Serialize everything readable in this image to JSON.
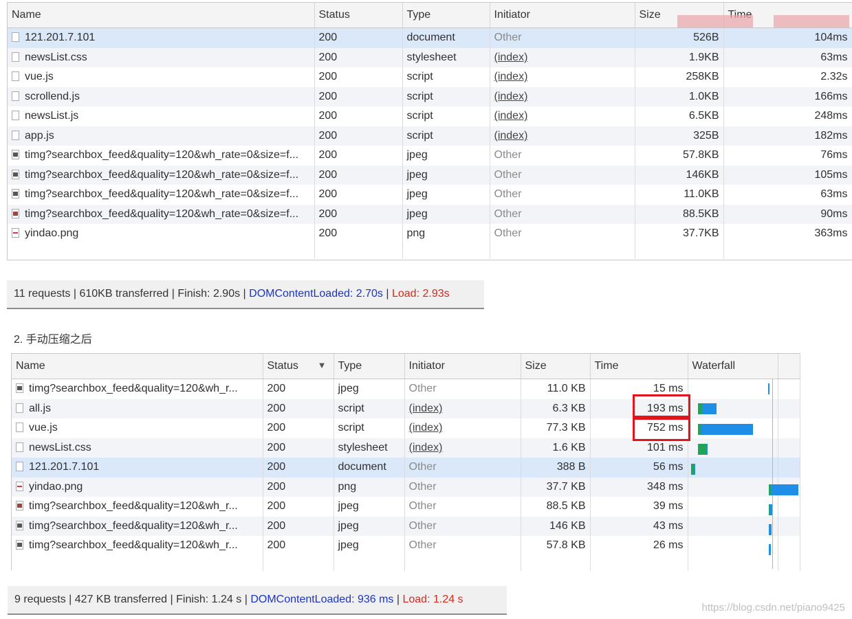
{
  "top": {
    "headers": {
      "name": "Name",
      "status": "Status",
      "type": "Type",
      "initiator": "Initiator",
      "size": "Size",
      "time": "Time"
    },
    "rows": [
      {
        "name": "121.201.7.101",
        "icon": "doc",
        "status": "200",
        "type": "document",
        "initiator": "Other",
        "init_link": false,
        "size": "526B",
        "time": "104ms"
      },
      {
        "name": "newsList.css",
        "icon": "doc",
        "status": "200",
        "type": "stylesheet",
        "initiator": "(index)",
        "init_link": true,
        "size": "1.9KB",
        "time": "63ms"
      },
      {
        "name": "vue.js",
        "icon": "doc",
        "status": "200",
        "type": "script",
        "initiator": "(index)",
        "init_link": true,
        "size": "258KB",
        "time": "2.32s"
      },
      {
        "name": "scrollend.js",
        "icon": "doc",
        "status": "200",
        "type": "script",
        "initiator": "(index)",
        "init_link": true,
        "size": "1.0KB",
        "time": "166ms"
      },
      {
        "name": "newsList.js",
        "icon": "doc",
        "status": "200",
        "type": "script",
        "initiator": "(index)",
        "init_link": true,
        "size": "6.5KB",
        "time": "248ms"
      },
      {
        "name": "app.js",
        "icon": "doc",
        "status": "200",
        "type": "script",
        "initiator": "(index)",
        "init_link": true,
        "size": "325B",
        "time": "182ms"
      },
      {
        "name": "timg?searchbox_feed&quality=120&wh_rate=0&size=f...",
        "icon": "img",
        "status": "200",
        "type": "jpeg",
        "initiator": "Other",
        "init_link": false,
        "size": "57.8KB",
        "time": "76ms"
      },
      {
        "name": "timg?searchbox_feed&quality=120&wh_rate=0&size=f...",
        "icon": "img",
        "status": "200",
        "type": "jpeg",
        "initiator": "Other",
        "init_link": false,
        "size": "146KB",
        "time": "105ms"
      },
      {
        "name": "timg?searchbox_feed&quality=120&wh_rate=0&size=f...",
        "icon": "img",
        "status": "200",
        "type": "jpeg",
        "initiator": "Other",
        "init_link": false,
        "size": "11.0KB",
        "time": "63ms"
      },
      {
        "name": "timg?searchbox_feed&quality=120&wh_rate=0&size=f...",
        "icon": "imgred",
        "status": "200",
        "type": "jpeg",
        "initiator": "Other",
        "init_link": false,
        "size": "88.5KB",
        "time": "90ms"
      },
      {
        "name": "yindao.png",
        "icon": "png",
        "status": "200",
        "type": "png",
        "initiator": "Other",
        "init_link": false,
        "size": "37.7KB",
        "time": "363ms"
      }
    ],
    "summary": {
      "requests": "11 requests",
      "transferred": "610KB transferred",
      "finish": "Finish: 2.90s",
      "dcl": "DOMContentLoaded: 2.70s",
      "load": "Load: 2.93s",
      "sep": " | "
    }
  },
  "section_title": "2. 手动压缩之后",
  "bottom": {
    "headers": {
      "name": "Name",
      "status": "Status",
      "sort_icon": "▼",
      "type": "Type",
      "initiator": "Initiator",
      "size": "Size",
      "time": "Time",
      "waterfall": "Waterfall"
    },
    "rows": [
      {
        "name": "timg?searchbox_feed&quality=120&wh_r...",
        "icon": "img",
        "status": "200",
        "type": "jpeg",
        "initiator": "Other",
        "init_link": false,
        "size": "11.0 KB",
        "time": "15 ms"
      },
      {
        "name": "all.js",
        "icon": "doc",
        "status": "200",
        "type": "script",
        "initiator": "(index)",
        "init_link": true,
        "size": "6.3 KB",
        "time": "193 ms"
      },
      {
        "name": "vue.js",
        "icon": "doc",
        "status": "200",
        "type": "script",
        "initiator": "(index)",
        "init_link": true,
        "size": "77.3 KB",
        "time": "752 ms"
      },
      {
        "name": "newsList.css",
        "icon": "doc",
        "status": "200",
        "type": "stylesheet",
        "initiator": "(index)",
        "init_link": true,
        "size": "1.6 KB",
        "time": "101 ms"
      },
      {
        "name": "121.201.7.101",
        "icon": "doc",
        "status": "200",
        "type": "document",
        "initiator": "Other",
        "init_link": false,
        "size": "388 B",
        "time": "56 ms"
      },
      {
        "name": "yindao.png",
        "icon": "png",
        "status": "200",
        "type": "png",
        "initiator": "Other",
        "init_link": false,
        "size": "37.7 KB",
        "time": "348 ms"
      },
      {
        "name": "timg?searchbox_feed&quality=120&wh_r...",
        "icon": "imgred",
        "status": "200",
        "type": "jpeg",
        "initiator": "Other",
        "init_link": false,
        "size": "88.5 KB",
        "time": "39 ms"
      },
      {
        "name": "timg?searchbox_feed&quality=120&wh_r...",
        "icon": "img",
        "status": "200",
        "type": "jpeg",
        "initiator": "Other",
        "init_link": false,
        "size": "146 KB",
        "time": "43 ms"
      },
      {
        "name": "timg?searchbox_feed&quality=120&wh_r...",
        "icon": "img",
        "status": "200",
        "type": "jpeg",
        "initiator": "Other",
        "init_link": false,
        "size": "57.8 KB",
        "time": "26 ms"
      }
    ],
    "summary": {
      "requests": "9 requests",
      "transferred": "427 KB transferred",
      "finish": "Finish: 1.24 s",
      "dcl": "DOMContentLoaded: 936 ms",
      "load": "Load: 1.24 s",
      "sep": " | "
    }
  },
  "watermark": "https://blog.csdn.net/piano9425",
  "colors": {
    "waterfall_blue": "#1e8ee6",
    "waterfall_green": "#1fa45a",
    "highlight": "#e0141c",
    "dcl": "#1a33c9",
    "load": "#d42a1c"
  }
}
